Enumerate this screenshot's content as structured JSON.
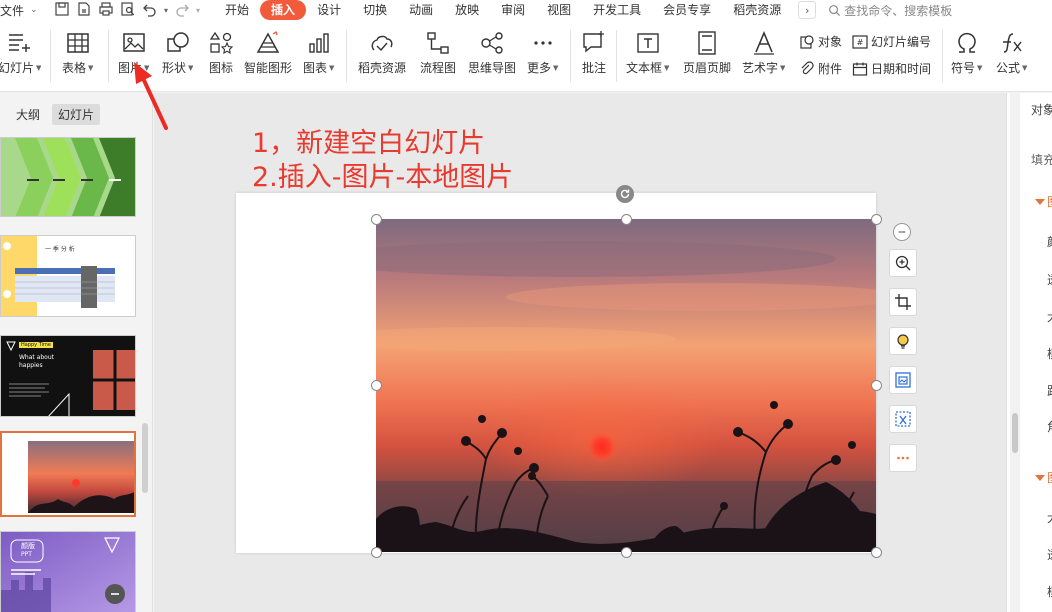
{
  "menu": {
    "file_label": "文件",
    "tabs": [
      {
        "label": "开始",
        "active": false
      },
      {
        "label": "插入",
        "active": true
      },
      {
        "label": "设计",
        "active": false
      },
      {
        "label": "切换",
        "active": false
      },
      {
        "label": "动画",
        "active": false
      },
      {
        "label": "放映",
        "active": false
      },
      {
        "label": "审阅",
        "active": false
      },
      {
        "label": "视图",
        "active": false
      },
      {
        "label": "开发工具",
        "active": false
      },
      {
        "label": "会员专享",
        "active": false
      },
      {
        "label": "稻壳资源",
        "active": false
      }
    ],
    "search_placeholder": "查找命令、搜索模板",
    "accent_color": "#f15a3a"
  },
  "ribbon": {
    "new_slide": "幻灯片",
    "table": "表格",
    "picture": "图片",
    "shape": "形状",
    "icon": "图标",
    "smart_graphic": "智能图形",
    "chart": "图表",
    "docer_resources": "稻壳资源",
    "flowchart": "流程图",
    "mindmap": "思维导图",
    "more": "更多",
    "comment": "批注",
    "textbox": "文本框",
    "header_footer": "页眉页脚",
    "wordart": "艺术字",
    "object": "对象",
    "attachment": "附件",
    "slide_number": "幻灯片编号",
    "date_time": "日期和时间",
    "symbol": "符号",
    "formula": "公式"
  },
  "left_panel": {
    "outline_tab": "大纲",
    "slides_tab": "幻灯片",
    "thumb3_title": "Happy Time",
    "thumb3_line1": "What about",
    "thumb3_line2": "happies",
    "thumb5_badge_top": "颜版",
    "thumb5_badge_bottom": "PPT",
    "thumb2_title": "一 季 分 析"
  },
  "canvas": {
    "instruction_line1": "1，新建空白幻灯片",
    "instruction_line2": "2.插入-图片-本地图片",
    "annotation_color": "#e83a2e"
  },
  "right_panel": {
    "title_partial": "对象",
    "fill_partial": "填充",
    "section1_partial": "图",
    "row1": "颜",
    "row2": "透",
    "row3": "大",
    "row4": "模",
    "row5": "距",
    "row6": "角",
    "section2_partial": "图",
    "row7": "大",
    "row8": "透",
    "row9": "模"
  }
}
